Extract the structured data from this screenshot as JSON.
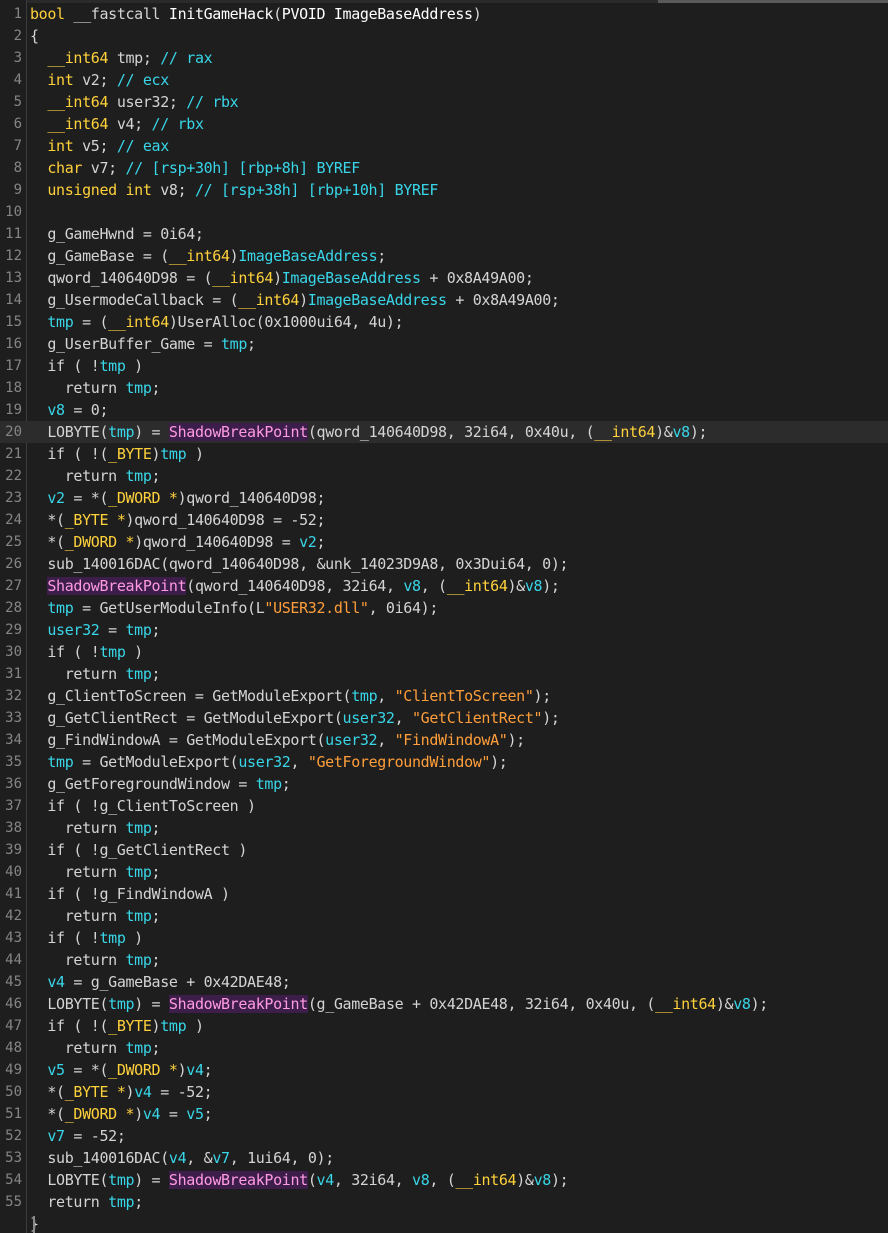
{
  "editor": {
    "function_signature": "bool __fastcall InitGameHack(PVOID ImageBaseAddress)",
    "highlighted_line": 20,
    "colors": {
      "background": "#1e1e1e",
      "keyword": "#ffd13b",
      "variable": "#38d6e8",
      "function": "#ffffff",
      "string": "#ff9e3a",
      "highlight_fn_bg": "#3d1d4a",
      "line_number": "#858585"
    },
    "lines": [
      {
        "n": "1",
        "tokens": [
          [
            "k",
            "bool"
          ],
          [
            "p",
            " __fastcall "
          ],
          [
            "f",
            "InitGameHack"
          ],
          [
            "p",
            "("
          ],
          [
            "f",
            "PVOID ImageBaseAddress"
          ],
          [
            "p",
            ")"
          ]
        ]
      },
      {
        "n": "2",
        "tokens": [
          [
            "p",
            "{"
          ]
        ]
      },
      {
        "n": "3",
        "tokens": [
          [
            "k",
            "  __int64"
          ],
          [
            "p",
            " tmp; "
          ],
          [
            "c",
            "// rax"
          ]
        ]
      },
      {
        "n": "4",
        "tokens": [
          [
            "k",
            "  int"
          ],
          [
            "p",
            " v2; "
          ],
          [
            "c",
            "// ecx"
          ]
        ]
      },
      {
        "n": "5",
        "tokens": [
          [
            "k",
            "  __int64"
          ],
          [
            "p",
            " user32; "
          ],
          [
            "c",
            "// rbx"
          ]
        ]
      },
      {
        "n": "6",
        "tokens": [
          [
            "k",
            "  __int64"
          ],
          [
            "p",
            " v4; "
          ],
          [
            "c",
            "// rbx"
          ]
        ]
      },
      {
        "n": "7",
        "tokens": [
          [
            "k",
            "  int"
          ],
          [
            "p",
            " v5; "
          ],
          [
            "c",
            "// eax"
          ]
        ]
      },
      {
        "n": "8",
        "tokens": [
          [
            "k",
            "  char"
          ],
          [
            "p",
            " v7; "
          ],
          [
            "c",
            "// [rsp+30h] [rbp+8h] BYREF"
          ]
        ]
      },
      {
        "n": "9",
        "tokens": [
          [
            "k",
            "  unsigned int"
          ],
          [
            "p",
            " v8; "
          ],
          [
            "c",
            "// [rsp+38h] [rbp+10h] BYREF"
          ]
        ]
      },
      {
        "n": "10",
        "tokens": []
      },
      {
        "n": "11",
        "tokens": [
          [
            "p",
            "  g_GameHwnd = 0i64;"
          ]
        ]
      },
      {
        "n": "12",
        "tokens": [
          [
            "p",
            "  g_GameBase = ("
          ],
          [
            "k",
            "__int64"
          ],
          [
            "p",
            ")"
          ],
          [
            "v",
            "ImageBaseAddress"
          ],
          [
            "p",
            ";"
          ]
        ]
      },
      {
        "n": "13",
        "tokens": [
          [
            "p",
            "  qword_140640D98 = ("
          ],
          [
            "k",
            "__int64"
          ],
          [
            "p",
            ")"
          ],
          [
            "v",
            "ImageBaseAddress"
          ],
          [
            "p",
            " + 0x8A49A00;"
          ]
        ]
      },
      {
        "n": "14",
        "tokens": [
          [
            "p",
            "  g_UsermodeCallback = ("
          ],
          [
            "k",
            "__int64"
          ],
          [
            "p",
            ")"
          ],
          [
            "v",
            "ImageBaseAddress"
          ],
          [
            "p",
            " + 0x8A49A00;"
          ]
        ]
      },
      {
        "n": "15",
        "tokens": [
          [
            "v",
            "  tmp"
          ],
          [
            "p",
            " = ("
          ],
          [
            "k",
            "__int64"
          ],
          [
            "p",
            ")UserAlloc(0x1000ui64, 4u);"
          ]
        ]
      },
      {
        "n": "16",
        "tokens": [
          [
            "p",
            "  g_UserBuffer_Game = "
          ],
          [
            "v",
            "tmp"
          ],
          [
            "p",
            ";"
          ]
        ]
      },
      {
        "n": "17",
        "tokens": [
          [
            "p",
            "  if ( !"
          ],
          [
            "v",
            "tmp"
          ],
          [
            "p",
            " )"
          ]
        ]
      },
      {
        "n": "18",
        "tokens": [
          [
            "p",
            "    return "
          ],
          [
            "v",
            "tmp"
          ],
          [
            "p",
            ";"
          ]
        ]
      },
      {
        "n": "19",
        "tokens": [
          [
            "v",
            "  v8"
          ],
          [
            "p",
            " = 0;"
          ]
        ]
      },
      {
        "n": "20",
        "tokens": [
          [
            "p",
            "  LOBYTE("
          ],
          [
            "v",
            "tmp"
          ],
          [
            "p",
            ") = "
          ],
          [
            "h",
            "ShadowBreakPoint"
          ],
          [
            "p",
            "(qword_140640D98, 32i64, 0x40u, ("
          ],
          [
            "k",
            "__int64"
          ],
          [
            "p",
            ")&"
          ],
          [
            "v",
            "v8"
          ],
          [
            "p",
            ");"
          ]
        ]
      },
      {
        "n": "21",
        "tokens": [
          [
            "p",
            "  if ( !("
          ],
          [
            "k",
            "_BYTE"
          ],
          [
            "p",
            ")"
          ],
          [
            "v",
            "tmp"
          ],
          [
            "p",
            " )"
          ]
        ]
      },
      {
        "n": "22",
        "tokens": [
          [
            "p",
            "    return "
          ],
          [
            "v",
            "tmp"
          ],
          [
            "p",
            ";"
          ]
        ]
      },
      {
        "n": "23",
        "tokens": [
          [
            "v",
            "  v2"
          ],
          [
            "p",
            " = *("
          ],
          [
            "k",
            "_DWORD *"
          ],
          [
            "p",
            ")qword_140640D98;"
          ]
        ]
      },
      {
        "n": "24",
        "tokens": [
          [
            "p",
            "  *("
          ],
          [
            "k",
            "_BYTE *"
          ],
          [
            "p",
            ")qword_140640D98 = -52;"
          ]
        ]
      },
      {
        "n": "25",
        "tokens": [
          [
            "p",
            "  *("
          ],
          [
            "k",
            "_DWORD *"
          ],
          [
            "p",
            ")qword_140640D98 = "
          ],
          [
            "v",
            "v2"
          ],
          [
            "p",
            ";"
          ]
        ]
      },
      {
        "n": "26",
        "tokens": [
          [
            "p",
            "  sub_140016DAC(qword_140640D98, &unk_14023D9A8, 0x3Dui64, 0);"
          ]
        ]
      },
      {
        "n": "27",
        "tokens": [
          [
            "p",
            "  "
          ],
          [
            "h",
            "ShadowBreakPoint"
          ],
          [
            "p",
            "(qword_140640D98, 32i64, "
          ],
          [
            "v",
            "v8"
          ],
          [
            "p",
            ", ("
          ],
          [
            "k",
            "__int64"
          ],
          [
            "p",
            ")&"
          ],
          [
            "v",
            "v8"
          ],
          [
            "p",
            ");"
          ]
        ]
      },
      {
        "n": "28",
        "tokens": [
          [
            "v",
            "  tmp"
          ],
          [
            "p",
            " = GetUserModuleInfo(L"
          ],
          [
            "s",
            "\"USER32.dll\""
          ],
          [
            "p",
            ", 0i64);"
          ]
        ]
      },
      {
        "n": "29",
        "tokens": [
          [
            "v",
            "  user32"
          ],
          [
            "p",
            " = "
          ],
          [
            "v",
            "tmp"
          ],
          [
            "p",
            ";"
          ]
        ]
      },
      {
        "n": "30",
        "tokens": [
          [
            "p",
            "  if ( !"
          ],
          [
            "v",
            "tmp"
          ],
          [
            "p",
            " )"
          ]
        ]
      },
      {
        "n": "31",
        "tokens": [
          [
            "p",
            "    return "
          ],
          [
            "v",
            "tmp"
          ],
          [
            "p",
            ";"
          ]
        ]
      },
      {
        "n": "32",
        "tokens": [
          [
            "p",
            "  g_ClientToScreen = GetModuleExport("
          ],
          [
            "v",
            "tmp"
          ],
          [
            "p",
            ", "
          ],
          [
            "s",
            "\"ClientToScreen\""
          ],
          [
            "p",
            ");"
          ]
        ]
      },
      {
        "n": "33",
        "tokens": [
          [
            "p",
            "  g_GetClientRect = GetModuleExport("
          ],
          [
            "v",
            "user32"
          ],
          [
            "p",
            ", "
          ],
          [
            "s",
            "\"GetClientRect\""
          ],
          [
            "p",
            ");"
          ]
        ]
      },
      {
        "n": "34",
        "tokens": [
          [
            "p",
            "  g_FindWindowA = GetModuleExport("
          ],
          [
            "v",
            "user32"
          ],
          [
            "p",
            ", "
          ],
          [
            "s",
            "\"FindWindowA\""
          ],
          [
            "p",
            ");"
          ]
        ]
      },
      {
        "n": "35",
        "tokens": [
          [
            "v",
            "  tmp"
          ],
          [
            "p",
            " = GetModuleExport("
          ],
          [
            "v",
            "user32"
          ],
          [
            "p",
            ", "
          ],
          [
            "s",
            "\"GetForegroundWindow\""
          ],
          [
            "p",
            ");"
          ]
        ]
      },
      {
        "n": "36",
        "tokens": [
          [
            "p",
            "  g_GetForegroundWindow = "
          ],
          [
            "v",
            "tmp"
          ],
          [
            "p",
            ";"
          ]
        ]
      },
      {
        "n": "37",
        "tokens": [
          [
            "p",
            "  if ( !g_ClientToScreen )"
          ]
        ]
      },
      {
        "n": "38",
        "tokens": [
          [
            "p",
            "    return "
          ],
          [
            "v",
            "tmp"
          ],
          [
            "p",
            ";"
          ]
        ]
      },
      {
        "n": "39",
        "tokens": [
          [
            "p",
            "  if ( !g_GetClientRect )"
          ]
        ]
      },
      {
        "n": "40",
        "tokens": [
          [
            "p",
            "    return "
          ],
          [
            "v",
            "tmp"
          ],
          [
            "p",
            ";"
          ]
        ]
      },
      {
        "n": "41",
        "tokens": [
          [
            "p",
            "  if ( !g_FindWindowA )"
          ]
        ]
      },
      {
        "n": "42",
        "tokens": [
          [
            "p",
            "    return "
          ],
          [
            "v",
            "tmp"
          ],
          [
            "p",
            ";"
          ]
        ]
      },
      {
        "n": "43",
        "tokens": [
          [
            "p",
            "  if ( !"
          ],
          [
            "v",
            "tmp"
          ],
          [
            "p",
            " )"
          ]
        ]
      },
      {
        "n": "44",
        "tokens": [
          [
            "p",
            "    return "
          ],
          [
            "v",
            "tmp"
          ],
          [
            "p",
            ";"
          ]
        ]
      },
      {
        "n": "45",
        "tokens": [
          [
            "v",
            "  v4"
          ],
          [
            "p",
            " = g_GameBase + 0x42DAE48;"
          ]
        ]
      },
      {
        "n": "46",
        "tokens": [
          [
            "p",
            "  LOBYTE("
          ],
          [
            "v",
            "tmp"
          ],
          [
            "p",
            ") = "
          ],
          [
            "h",
            "ShadowBreakPoint"
          ],
          [
            "p",
            "(g_GameBase + 0x42DAE48, 32i64, 0x40u, ("
          ],
          [
            "k",
            "__int64"
          ],
          [
            "p",
            ")&"
          ],
          [
            "v",
            "v8"
          ],
          [
            "p",
            ");"
          ]
        ]
      },
      {
        "n": "47",
        "tokens": [
          [
            "p",
            "  if ( !("
          ],
          [
            "k",
            "_BYTE"
          ],
          [
            "p",
            ")"
          ],
          [
            "v",
            "tmp"
          ],
          [
            "p",
            " )"
          ]
        ]
      },
      {
        "n": "48",
        "tokens": [
          [
            "p",
            "    return "
          ],
          [
            "v",
            "tmp"
          ],
          [
            "p",
            ";"
          ]
        ]
      },
      {
        "n": "49",
        "tokens": [
          [
            "v",
            "  v5"
          ],
          [
            "p",
            " = *("
          ],
          [
            "k",
            "_DWORD *"
          ],
          [
            "p",
            ")"
          ],
          [
            "v",
            "v4"
          ],
          [
            "p",
            ";"
          ]
        ]
      },
      {
        "n": "50",
        "tokens": [
          [
            "p",
            "  *("
          ],
          [
            "k",
            "_BYTE *"
          ],
          [
            "p",
            ")"
          ],
          [
            "v",
            "v4"
          ],
          [
            "p",
            " = -52;"
          ]
        ]
      },
      {
        "n": "51",
        "tokens": [
          [
            "p",
            "  *("
          ],
          [
            "k",
            "_DWORD *"
          ],
          [
            "p",
            ")"
          ],
          [
            "v",
            "v4"
          ],
          [
            "p",
            " = "
          ],
          [
            "v",
            "v5"
          ],
          [
            "p",
            ";"
          ]
        ]
      },
      {
        "n": "52",
        "tokens": [
          [
            "v",
            "  v7"
          ],
          [
            "p",
            " = -52;"
          ]
        ]
      },
      {
        "n": "53",
        "tokens": [
          [
            "p",
            "  sub_140016DAC("
          ],
          [
            "v",
            "v4"
          ],
          [
            "p",
            ", &"
          ],
          [
            "v",
            "v7"
          ],
          [
            "p",
            ", 1ui64, 0);"
          ]
        ]
      },
      {
        "n": "54",
        "tokens": [
          [
            "p",
            "  LOBYTE("
          ],
          [
            "v",
            "tmp"
          ],
          [
            "p",
            ") = "
          ],
          [
            "h",
            "ShadowBreakPoint"
          ],
          [
            "p",
            "("
          ],
          [
            "v",
            "v4"
          ],
          [
            "p",
            ", 32i64, "
          ],
          [
            "v",
            "v8"
          ],
          [
            "p",
            ", ("
          ],
          [
            "k",
            "__int64"
          ],
          [
            "p",
            ")&"
          ],
          [
            "v",
            "v8"
          ],
          [
            "p",
            ");"
          ]
        ]
      },
      {
        "n": "55",
        "tokens": [
          [
            "p",
            "  return "
          ],
          [
            "v",
            "tmp"
          ],
          [
            "p",
            ";"
          ]
        ]
      },
      {
        "n": "",
        "tokens": [
          [
            "p",
            "}"
          ]
        ]
      }
    ]
  }
}
